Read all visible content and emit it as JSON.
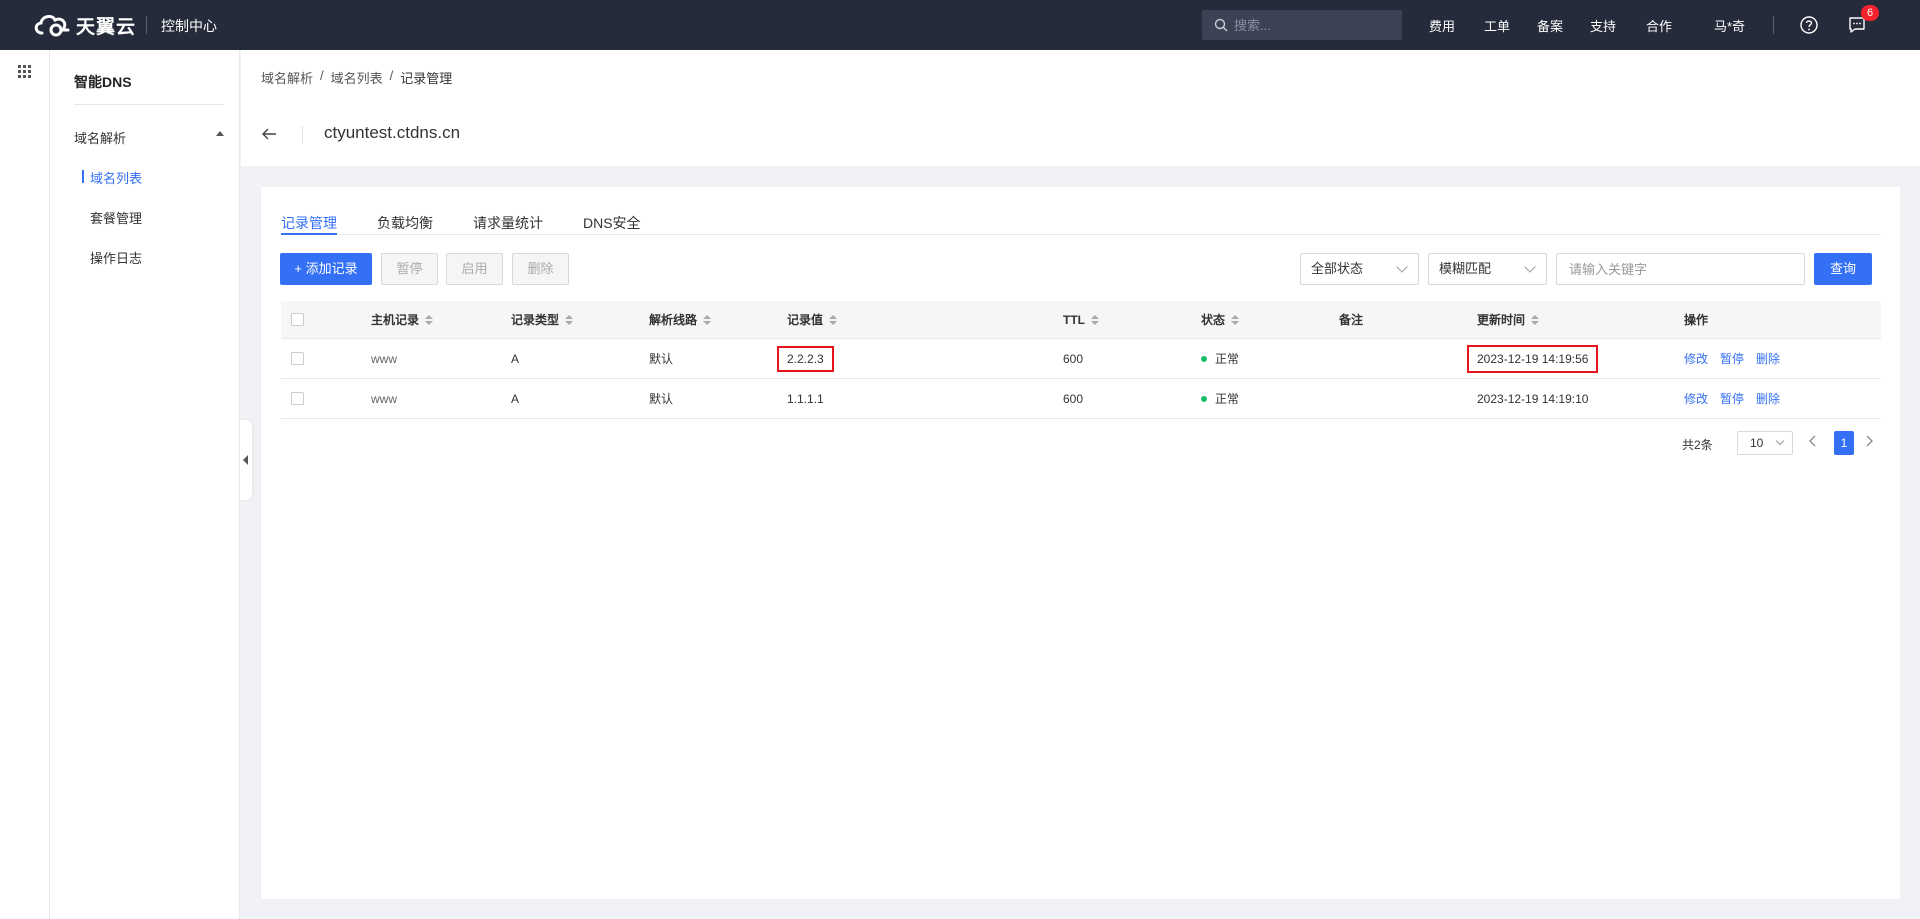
{
  "topbar": {
    "brand": "天翼云",
    "console": "控制中心",
    "search_placeholder": "搜索...",
    "nav": [
      "费用",
      "工单",
      "备案",
      "支持",
      "合作"
    ],
    "user": "马*奇",
    "message_count": "6"
  },
  "sidebar": {
    "title": "智能DNS",
    "group": "域名解析",
    "items": [
      "域名列表",
      "套餐管理",
      "操作日志"
    ],
    "active_index": 0
  },
  "header": {
    "breadcrumb": [
      "域名解析",
      "/",
      "域名列表",
      "/",
      "记录管理"
    ],
    "domain": "ctyuntest.ctdns.cn"
  },
  "tabs": [
    "记录管理",
    "负载均衡",
    "请求量统计",
    "DNS安全"
  ],
  "toolbar": {
    "add": "+ 添加记录",
    "pause": "暂停",
    "enable": "启用",
    "delete": "删除",
    "status_filter": "全部状态",
    "match_mode": "模糊匹配",
    "keyword_placeholder": "请输入关键字",
    "query": "查询"
  },
  "table": {
    "columns": [
      "主机记录",
      "记录类型",
      "解析线路",
      "记录值",
      "TTL",
      "状态",
      "备注",
      "更新时间",
      "操作"
    ],
    "rows": [
      {
        "host": "www",
        "type": "A",
        "line": "默认",
        "value": "2.2.2.3",
        "ttl": "600",
        "status": "正常",
        "remark": "",
        "updated": "2023-12-19 14:19:56"
      },
      {
        "host": "www",
        "type": "A",
        "line": "默认",
        "value": "1.1.1.1",
        "ttl": "600",
        "status": "正常",
        "remark": "",
        "updated": "2023-12-19 14:19:10"
      }
    ],
    "actions": [
      "修改",
      "暂停",
      "删除"
    ]
  },
  "pagination": {
    "total": "共2条",
    "page_size": "10",
    "current": "1"
  },
  "colors": {
    "topbar": "#252b3a",
    "accent": "#3470f5",
    "status_ok": "#19be6b",
    "highlight": "#e8141b"
  }
}
